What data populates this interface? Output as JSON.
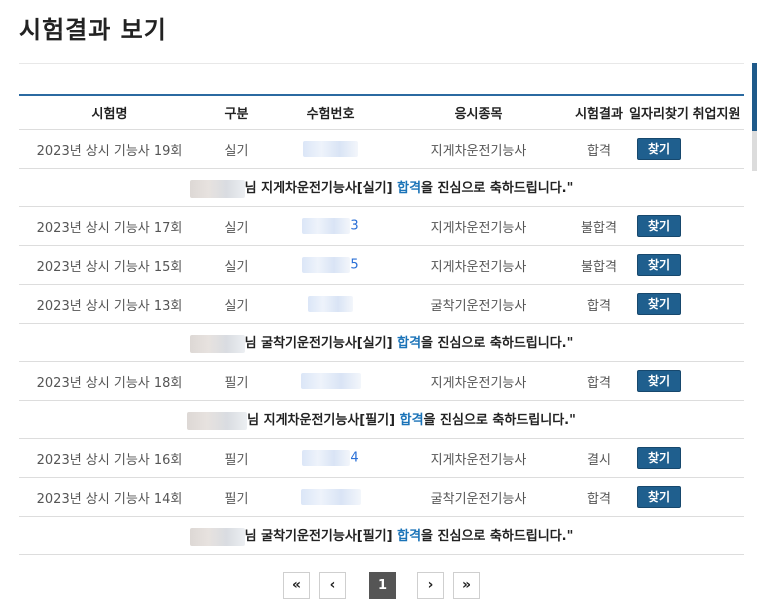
{
  "page": {
    "title": "시험결과 보기"
  },
  "table": {
    "headers": [
      "시험명",
      "구분",
      "수험번호",
      "응시종목",
      "시험결과",
      "일자리찾기",
      "취업지원"
    ],
    "find_label": "찾기",
    "rows": [
      {
        "exam": "2023년 상시 기능사 19회",
        "type": "실기",
        "exam_no": "05906128",
        "item": "지게차운전기능사",
        "result": "합격"
      },
      {
        "exam": "2023년 상시 기능사 17회",
        "type": "실기",
        "exam_no": "3",
        "item": "지게차운전기능사",
        "result": "불합격"
      },
      {
        "exam": "2023년 상시 기능사 15회",
        "type": "실기",
        "exam_no": "5",
        "item": "지게차운전기능사",
        "result": "불합격"
      },
      {
        "exam": "2023년 상시 기능사 13회",
        "type": "실기",
        "exam_no": "",
        "item": "굴착기운전기능사",
        "result": "합격"
      },
      {
        "exam": "2023년 상시 기능사 18회",
        "type": "필기",
        "exam_no": "05906755",
        "item": "지게차운전기능사",
        "result": "합격"
      },
      {
        "exam": "2023년 상시 기능사 16회",
        "type": "필기",
        "exam_no": "4",
        "item": "지게차운전기능사",
        "result": "결시"
      },
      {
        "exam": "2023년 상시 기능사 14회",
        "type": "필기",
        "exam_no": "05581128",
        "item": "굴착기운전기능사",
        "result": "합격"
      }
    ],
    "messages": [
      {
        "suffix": "님",
        "pre": " 지게차운전기능사[실기] ",
        "pass": "합격",
        "post": "을 진심으로 축하드립니다.\""
      },
      {
        "suffix": "님",
        "pre": " 굴착기운전기능사[실기] ",
        "pass": "합격",
        "post": "을 진심으로 축하드립니다.\""
      },
      {
        "suffix": "님",
        "pre": " 지게차운전기능사[필기] ",
        "pass": "합격",
        "post": "을 진심으로 축하드립니다.\""
      },
      {
        "suffix": "님",
        "pre": " 굴착기운전기능사[필기] ",
        "pass": "합격",
        "post": "을 진심으로 축하드립니다.\""
      }
    ]
  },
  "pagination": {
    "first": "«",
    "prev": "‹",
    "current": "1",
    "next": "›",
    "last": "»"
  }
}
